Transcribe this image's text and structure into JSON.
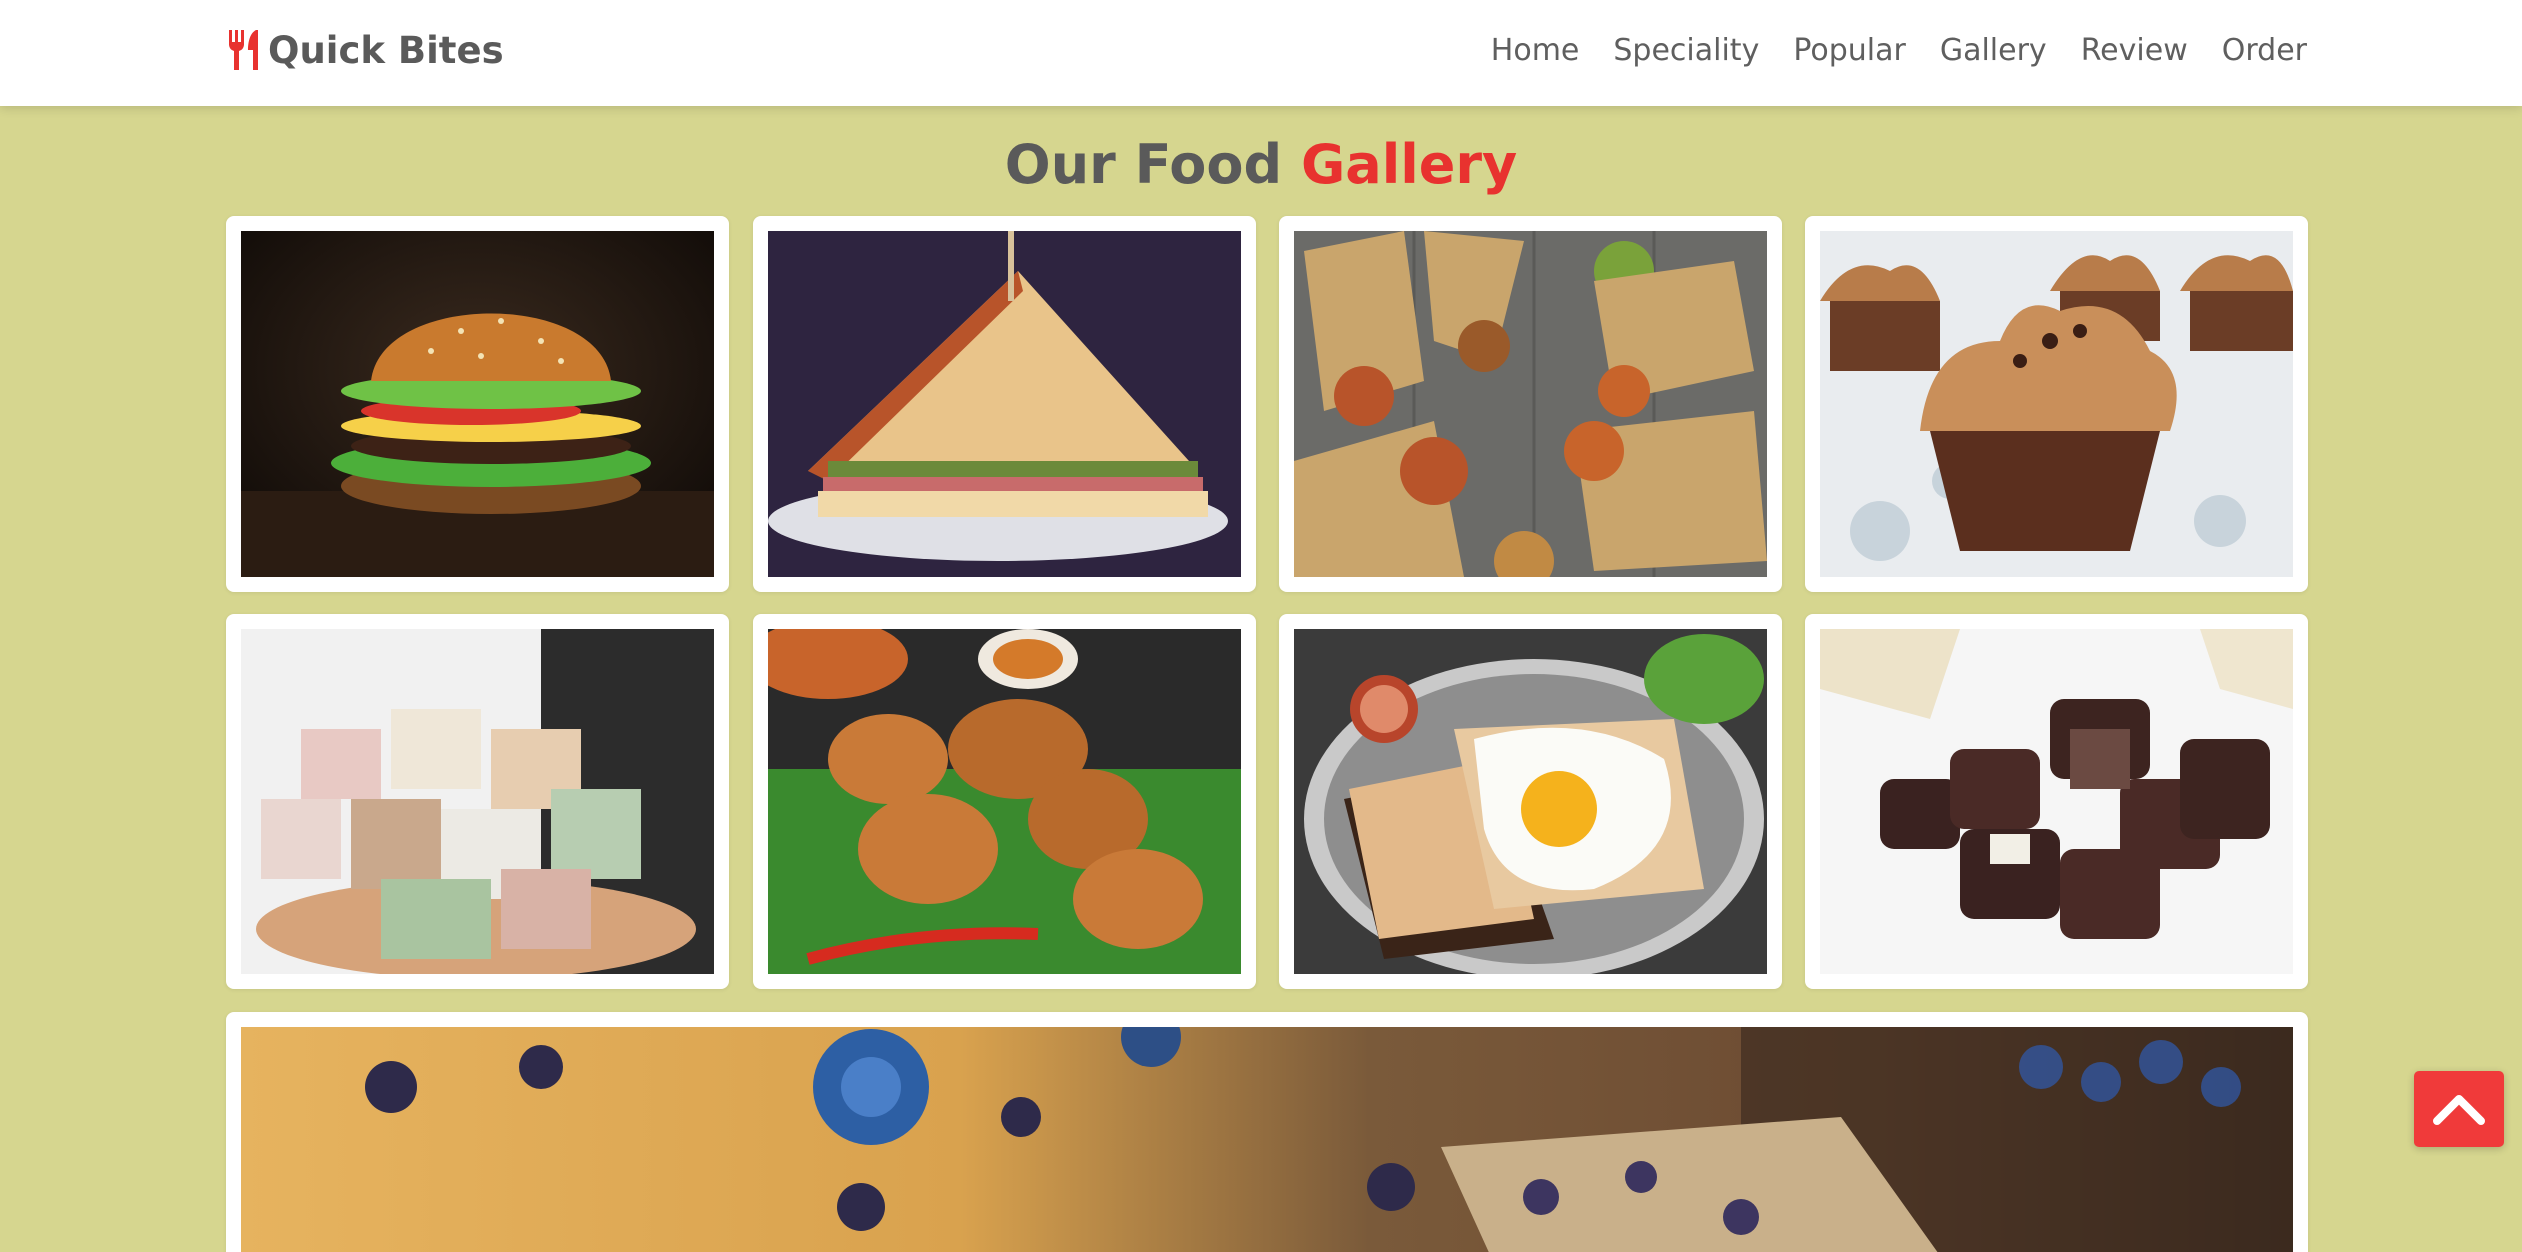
{
  "brand": {
    "name": "Quick Bites",
    "icon": "fork-knife-icon",
    "color": "#e8322f"
  },
  "nav": [
    {
      "label": "Home"
    },
    {
      "label": "Speciality"
    },
    {
      "label": "Popular"
    },
    {
      "label": "Gallery"
    },
    {
      "label": "Review"
    },
    {
      "label": "Order"
    }
  ],
  "gallery": {
    "title_plain": "Our Food",
    "title_accent": "Gallery",
    "images": [
      {
        "subject": "burger"
      },
      {
        "subject": "sandwich"
      },
      {
        "subject": "wraps"
      },
      {
        "subject": "cupcakes"
      },
      {
        "subject": "soap-cubes"
      },
      {
        "subject": "fried-chicken"
      },
      {
        "subject": "egg-toast"
      },
      {
        "subject": "chocolates"
      },
      {
        "subject": "blueberry-bread"
      }
    ]
  },
  "scroll_top": {
    "icon": "chevron-up-icon"
  },
  "colors": {
    "background": "#d6d68f",
    "accent": "#e8322f",
    "text": "#5a5a5a"
  }
}
